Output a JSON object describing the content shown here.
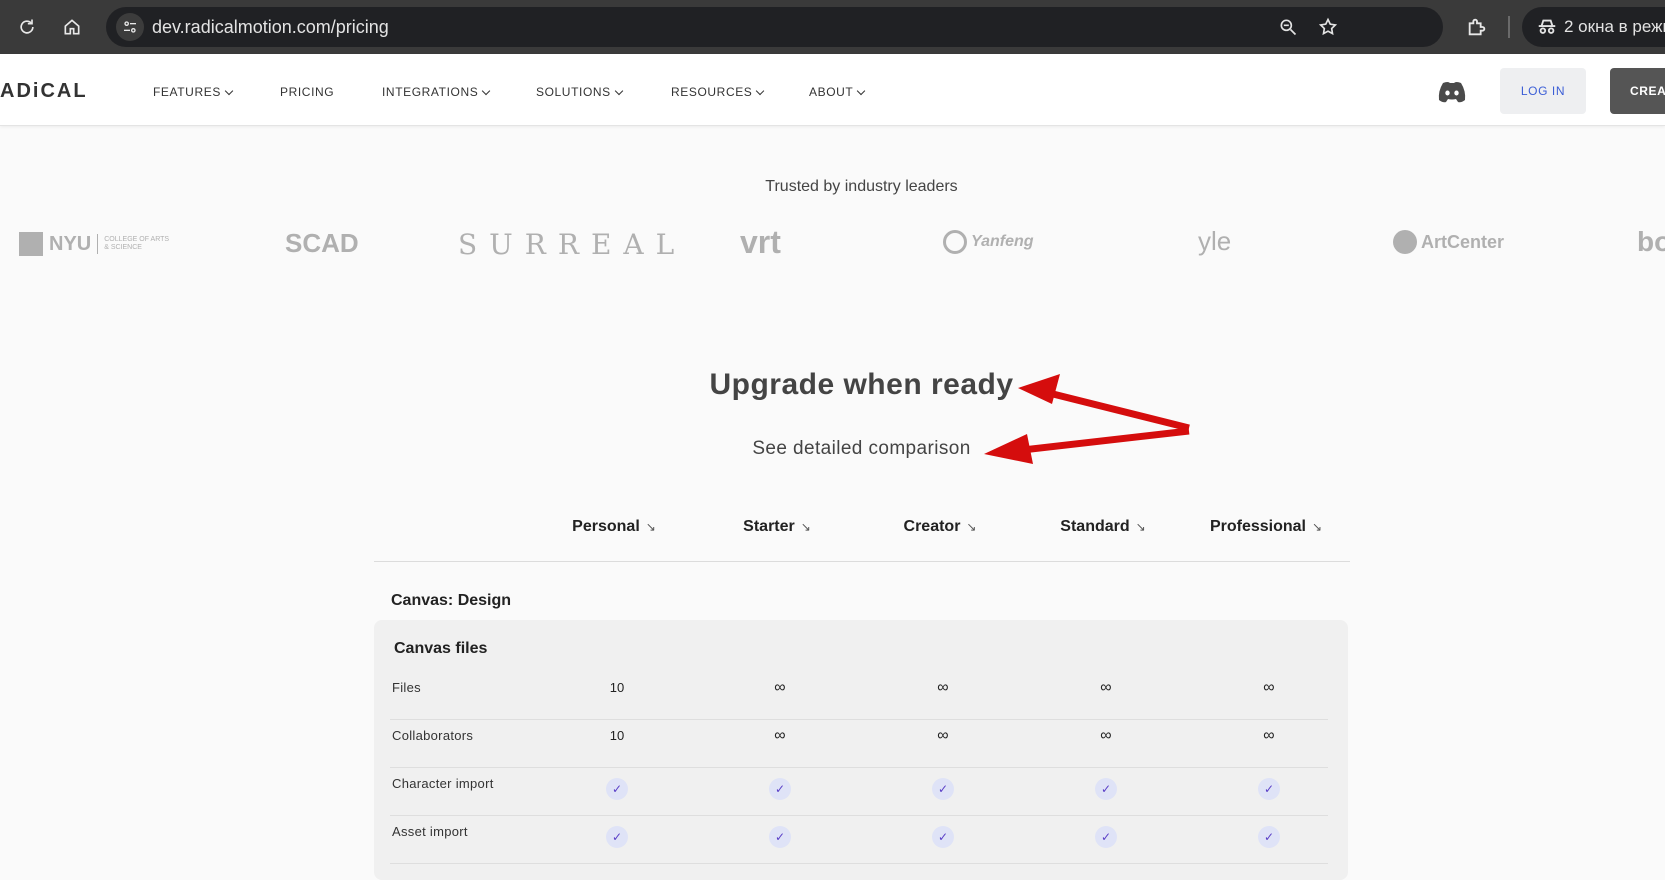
{
  "browser": {
    "url": "dev.radicalmotion.com/pricing",
    "incognito_label": "2 окна в режи",
    "icons": [
      "reload-icon",
      "home-icon",
      "site-info-icon",
      "zoom-icon",
      "star-icon",
      "extensions-icon",
      "incognito-icon"
    ]
  },
  "header": {
    "logo": "ADiCAL",
    "nav": [
      {
        "label": "FEATURES",
        "dropdown": true
      },
      {
        "label": "PRICING",
        "dropdown": false
      },
      {
        "label": "INTEGRATIONS",
        "dropdown": true
      },
      {
        "label": "SOLUTIONS",
        "dropdown": true
      },
      {
        "label": "RESOURCES",
        "dropdown": true
      },
      {
        "label": "ABOUT",
        "dropdown": true
      }
    ],
    "login_label": "LOG IN",
    "create_label": "CREAT"
  },
  "trusted": {
    "title": "Trusted by industry leaders",
    "logos": [
      "NYU",
      "COLLEGE OF ARTS & SCIENCE",
      "SCAD",
      "SURREAL",
      "vrt",
      "Yanfeng",
      "yle",
      "ArtCenter",
      "bo"
    ]
  },
  "hero": {
    "heading": "Upgrade when ready",
    "subheading": "See detailed comparison"
  },
  "plans": [
    {
      "name": "Personal",
      "arrow": "↘"
    },
    {
      "name": "Starter",
      "arrow": "↘"
    },
    {
      "name": "Creator",
      "arrow": "↘"
    },
    {
      "name": "Standard",
      "arrow": "↘"
    },
    {
      "name": "Professional",
      "arrow": "↘"
    }
  ],
  "section": {
    "title": "Canvas: Design",
    "panel_title": "Canvas files",
    "rows": [
      {
        "label": "Files",
        "values": [
          "10",
          "∞",
          "∞",
          "∞",
          "∞"
        ]
      },
      {
        "label": "Collaborators",
        "values": [
          "10",
          "∞",
          "∞",
          "∞",
          "∞"
        ]
      },
      {
        "label": "Character import",
        "values": [
          "check",
          "check",
          "check",
          "check",
          "check"
        ]
      },
      {
        "label": "Asset import",
        "values": [
          "check",
          "check",
          "check",
          "check",
          "check"
        ]
      }
    ]
  },
  "colors": {
    "annotation_arrow": "#d50d0d",
    "check_bg": "#dfe3f7",
    "check_mark": "#5b3fc7",
    "login_text": "#3b5ed6"
  }
}
